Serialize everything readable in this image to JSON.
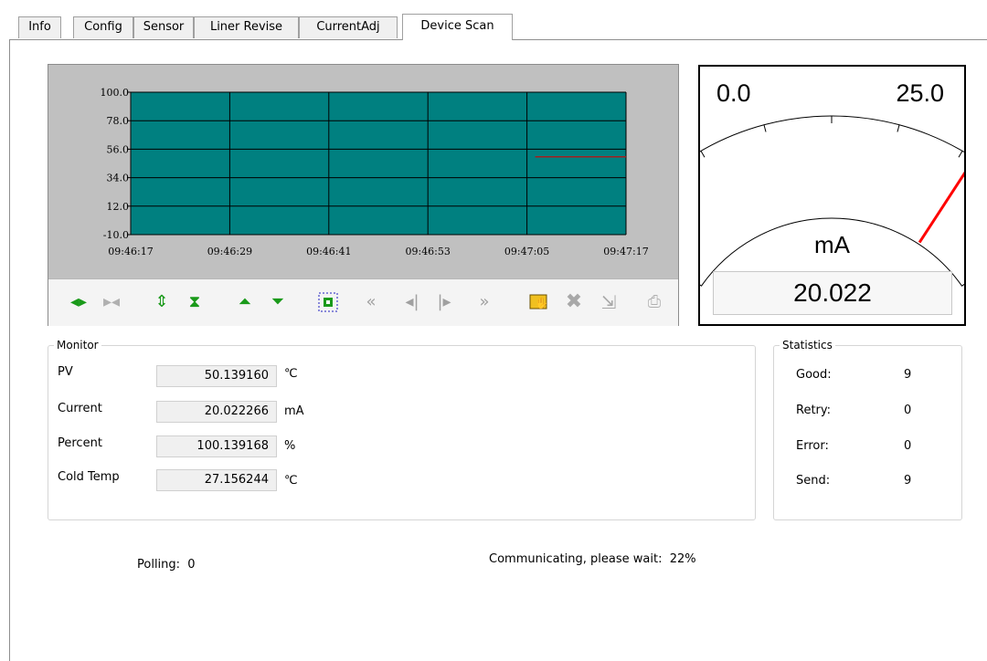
{
  "tabs": [
    {
      "label": "Info"
    },
    {
      "label": "Config"
    },
    {
      "label": "Sensor"
    },
    {
      "label": "Liner Revise"
    },
    {
      "label": "CurrentAdj"
    },
    {
      "label": "Device Scan"
    }
  ],
  "chart_data": {
    "type": "line",
    "y_ticks": [
      "100.0",
      "78.0",
      "56.0",
      "34.0",
      "12.0",
      "-10.0"
    ],
    "ylim": [
      -10.0,
      100.0
    ],
    "x_ticks": [
      "09:46:17",
      "09:46:29",
      "09:46:41",
      "09:46:53",
      "09:47:05",
      "09:47:17"
    ],
    "series": [
      {
        "color": "#a02020",
        "points": [
          {
            "x": "09:47:06",
            "y": 50.1
          },
          {
            "x": "09:47:17",
            "y": 50.1
          }
        ]
      }
    ],
    "plot_bg": "#008080",
    "grid": true
  },
  "toolbar_icons": [
    "expand-horizontal-icon",
    "shrink-horizontal-icon",
    "expand-vertical-icon",
    "shrink-vertical-icon",
    "shift-up-icon",
    "shift-down-icon",
    "zoom-fit-icon",
    "rewind-icon",
    "step-back-icon",
    "step-forward-icon",
    "fast-forward-icon",
    "hand-pan-icon",
    "clear-icon",
    "export-icon",
    "print-icon"
  ],
  "gauge": {
    "min_label": "0.0",
    "max_label": "25.0",
    "unit": "mA",
    "value": 20.022,
    "value_text": "20.022",
    "needle_color": "#ff0000"
  },
  "monitor": {
    "title": "Monitor",
    "rows": [
      {
        "label": "PV",
        "value": "50.139160",
        "unit": "℃"
      },
      {
        "label": "Current",
        "value": "20.022266",
        "unit": "mA"
      },
      {
        "label": "Percent",
        "value": "100.139168",
        "unit": "%"
      },
      {
        "label": "Cold Temp",
        "value": "27.156244",
        "unit": "℃"
      }
    ]
  },
  "statistics": {
    "title": "Statistics",
    "rows": [
      {
        "label": "Good:",
        "value": "9"
      },
      {
        "label": "Retry:",
        "value": "0"
      },
      {
        "label": "Error:",
        "value": "0"
      },
      {
        "label": "Send:",
        "value": "9"
      }
    ]
  },
  "status": {
    "polling": "Polling:  0",
    "communicating": "Communicating, please wait:  22%"
  }
}
